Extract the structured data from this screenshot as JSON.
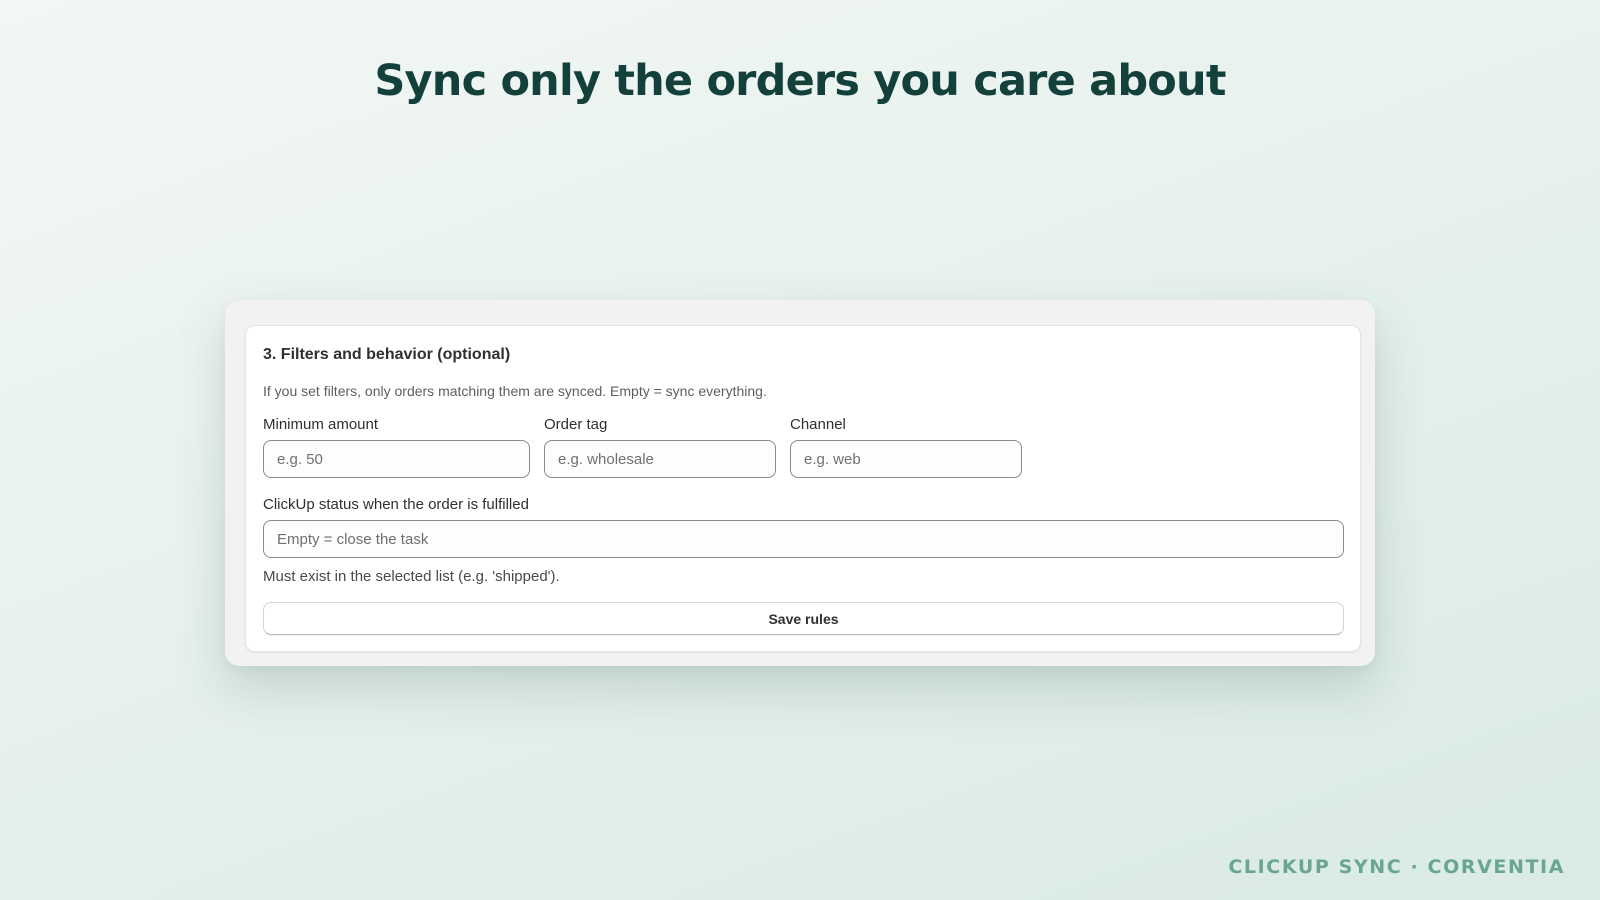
{
  "hero": {
    "title": "Sync only the orders you care about"
  },
  "section": {
    "heading": "3. Filters and behavior (optional)",
    "description": "If you set filters, only orders matching them are synced. Empty = sync everything."
  },
  "filters": {
    "min_amount": {
      "label": "Minimum amount",
      "value": "",
      "placeholder": "e.g. 50"
    },
    "order_tag": {
      "label": "Order tag",
      "value": "",
      "placeholder": "e.g. wholesale"
    },
    "channel": {
      "label": "Channel",
      "value": "",
      "placeholder": "e.g. web"
    }
  },
  "fulfilled_status": {
    "label": "ClickUp status when the order is fulfilled",
    "value": "",
    "placeholder": "Empty = close the task",
    "help": "Must exist in the selected list (e.g. 'shipped')."
  },
  "actions": {
    "save_label": "Save rules"
  },
  "footer": {
    "brand": "CLICKUP SYNC · CORVENTIA"
  },
  "colors": {
    "title": "#13403a",
    "brand": "#6aa493",
    "text": "#303030"
  }
}
